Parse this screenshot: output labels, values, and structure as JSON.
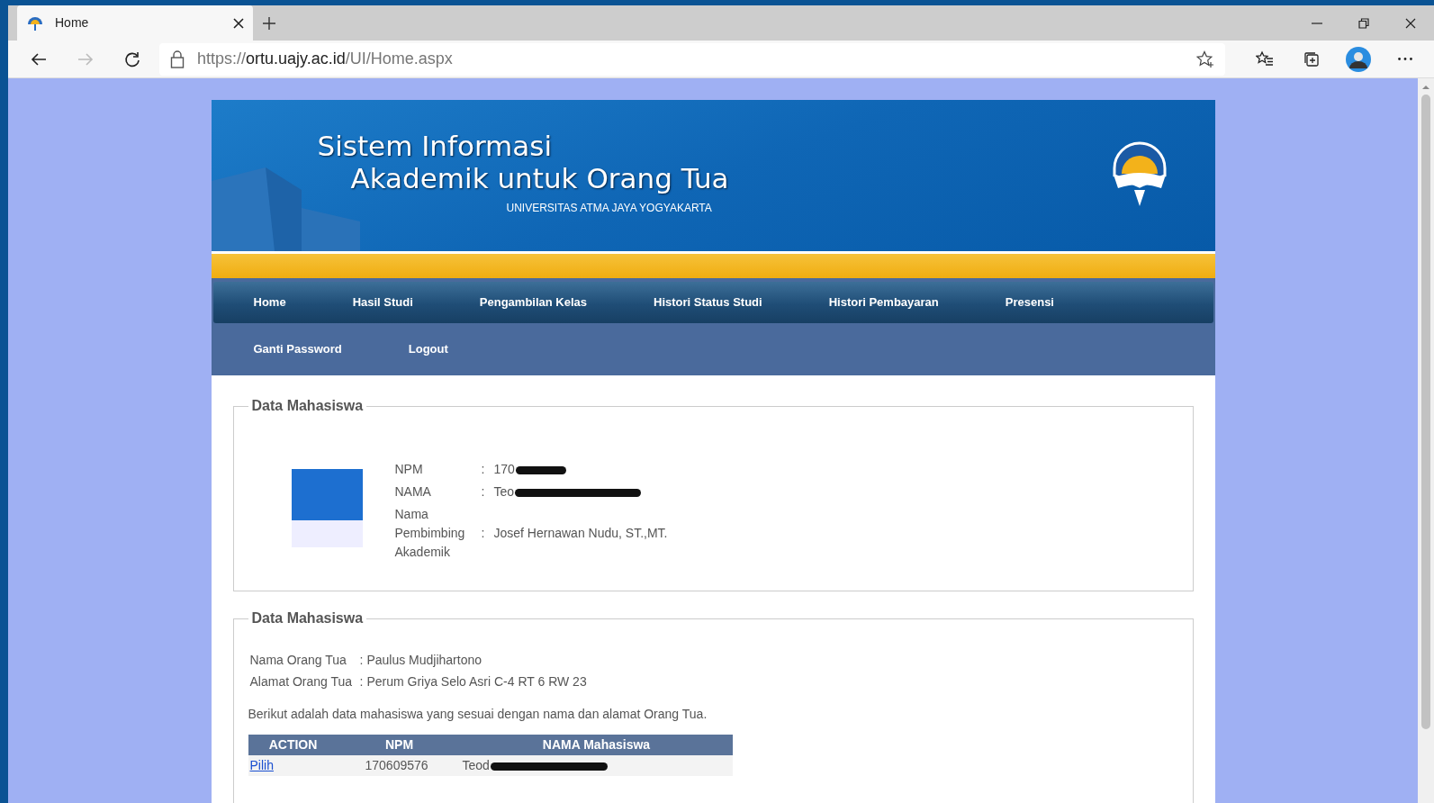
{
  "browser": {
    "tab": {
      "title": "Home",
      "selected": true
    },
    "url": {
      "scheme": "https://",
      "host": "ortu.uajy.ac.id",
      "path": "/UI/Home.aspx"
    },
    "forward_disabled": true
  },
  "header": {
    "title_line_1": "Sistem Informasi",
    "title_line_2": "Akademik untuk Orang Tua",
    "subtitle": "UNIVERSITAS ATMA JAYA YOGYAKARTA"
  },
  "menu": [
    [
      {
        "label": "Home"
      },
      {
        "label": "Hasil Studi"
      },
      {
        "label": "Pengambilan Kelas"
      },
      {
        "label": "Histori Status Studi"
      },
      {
        "label": "Histori Pembayaran"
      },
      {
        "label": "Presensi"
      }
    ],
    [
      {
        "label": "Ganti Password"
      },
      {
        "label": "Logout"
      }
    ]
  ],
  "student": {
    "legend": "Data Mahasiswa",
    "fields": [
      {
        "label": "NPM",
        "separator": ":",
        "value": "170",
        "redacted": true
      },
      {
        "label": "NAMA",
        "separator": ":",
        "value": "Teo",
        "redacted": true
      },
      {
        "label": "Nama Pembimbing Akademik",
        "separator": ":",
        "value": "Josef Hernawan Nudu, ST.,MT."
      }
    ]
  },
  "parent": {
    "legend": "Data Mahasiswa",
    "fields": [
      {
        "label": "Nama Orang Tua",
        "separator": ":",
        "value": "Paulus Mudjihartono"
      },
      {
        "label": "Alamat Orang Tua",
        "separator": ":",
        "value": "Perum Griya Selo Asri C-4 RT 6 RW 23"
      }
    ],
    "intro": "Berikut adalah data mahasiswa yang sesuai dengan nama dan alamat Orang Tua.",
    "table": {
      "columns": [
        "ACTION",
        "NPM",
        "NAMA Mahasiswa"
      ],
      "rows": [
        {
          "action": "Pilih",
          "npm": "170609576",
          "nama": "Teod",
          "redacted": true
        }
      ]
    }
  }
}
